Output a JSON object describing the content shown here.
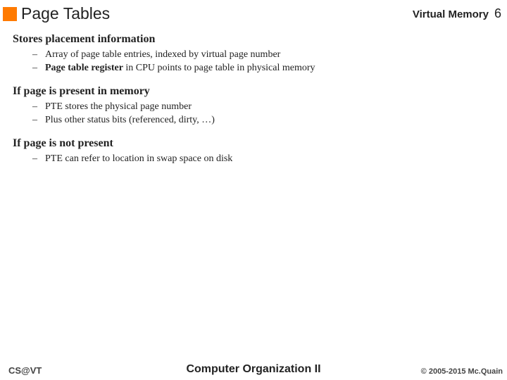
{
  "header": {
    "title": "Page Tables",
    "topic": "Virtual Memory",
    "page": "6"
  },
  "sections": [
    {
      "head": "Stores placement information",
      "items": [
        {
          "pre": "",
          "bold": "",
          "post": "Array of page table entries, indexed by virtual page number"
        },
        {
          "pre": "",
          "bold": "Page table register",
          "post": " in CPU points to page table in physical memory"
        }
      ]
    },
    {
      "head": "If page is present in memory",
      "items": [
        {
          "pre": "",
          "bold": "",
          "post": "PTE stores the physical page number"
        },
        {
          "pre": "",
          "bold": "",
          "post": "Plus other status bits (referenced, dirty, …)"
        }
      ]
    },
    {
      "head": "If page is not present",
      "items": [
        {
          "pre": "",
          "bold": "",
          "post": "PTE can refer to location in swap space on disk"
        }
      ]
    }
  ],
  "footer": {
    "left": "CS@VT",
    "center": "Computer Organization II",
    "right": "© 2005-2015 Mc.Quain"
  }
}
